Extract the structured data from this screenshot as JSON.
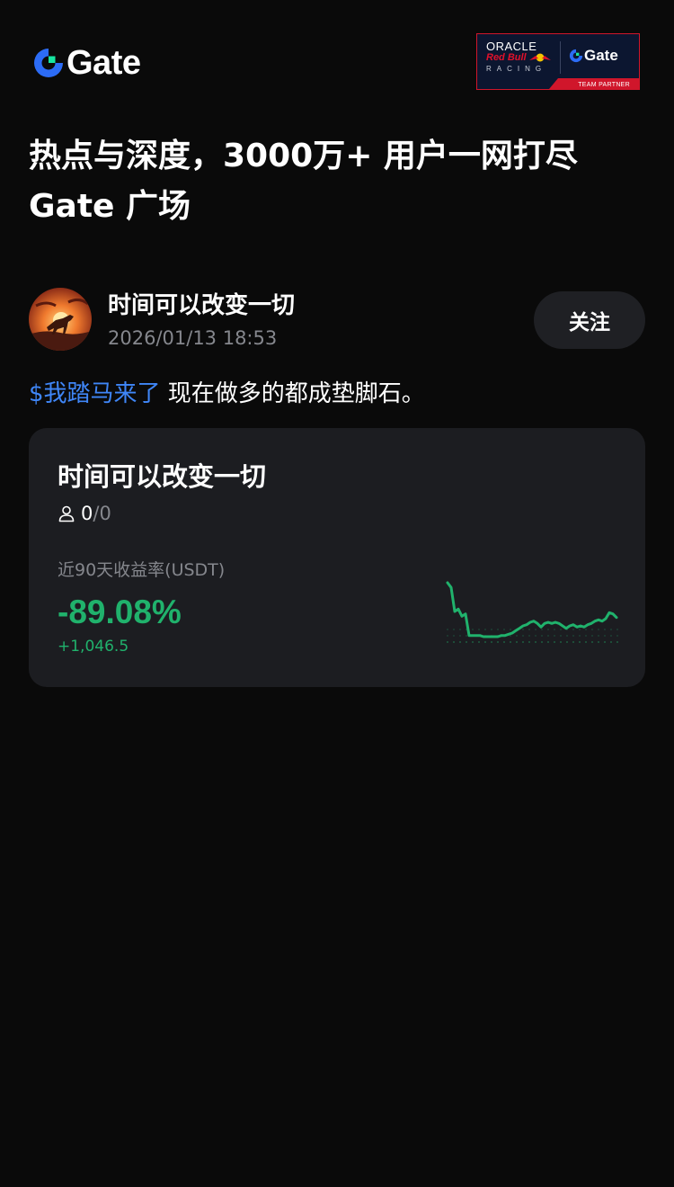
{
  "header": {
    "brand_name": "Gate",
    "partner_badge": {
      "oracle": "ORACLE",
      "redbull": "Red Bull",
      "racing": "RACING",
      "partner_brand": "Gate",
      "strip_text": "TEAM PARTNER"
    }
  },
  "headline": {
    "line1": "热点与深度，3000万+ 用户一网打尽",
    "line2": "Gate 广场"
  },
  "post": {
    "author_name": "时间可以改变一切",
    "timestamp": "2026/01/13 18:53",
    "follow_label": "关注",
    "tag": "$我踏马来了",
    "text": " 现在做多的都成垫脚石。"
  },
  "card": {
    "title": "时间可以改变一切",
    "followers_current": "0",
    "followers_rest": "/0",
    "metric_label": "近90天收益率(USDT)",
    "return_value": "-89.08%",
    "pnl_value": "+1,046.5",
    "line_color": "#20b26c"
  },
  "chart_data": {
    "type": "line",
    "title": "",
    "xlabel": "",
    "ylabel": "",
    "series": [
      {
        "values": [
          100,
          96,
          76,
          78,
          72,
          74,
          56,
          56,
          56,
          56,
          55,
          55,
          55,
          55,
          55,
          56,
          56,
          57,
          58,
          60,
          62,
          64,
          65,
          67,
          68,
          66,
          63,
          66,
          67,
          66,
          67,
          66,
          64,
          62,
          64,
          65,
          63,
          64,
          63,
          65,
          66,
          68,
          69,
          68,
          70,
          75,
          74,
          71
        ]
      }
    ]
  }
}
